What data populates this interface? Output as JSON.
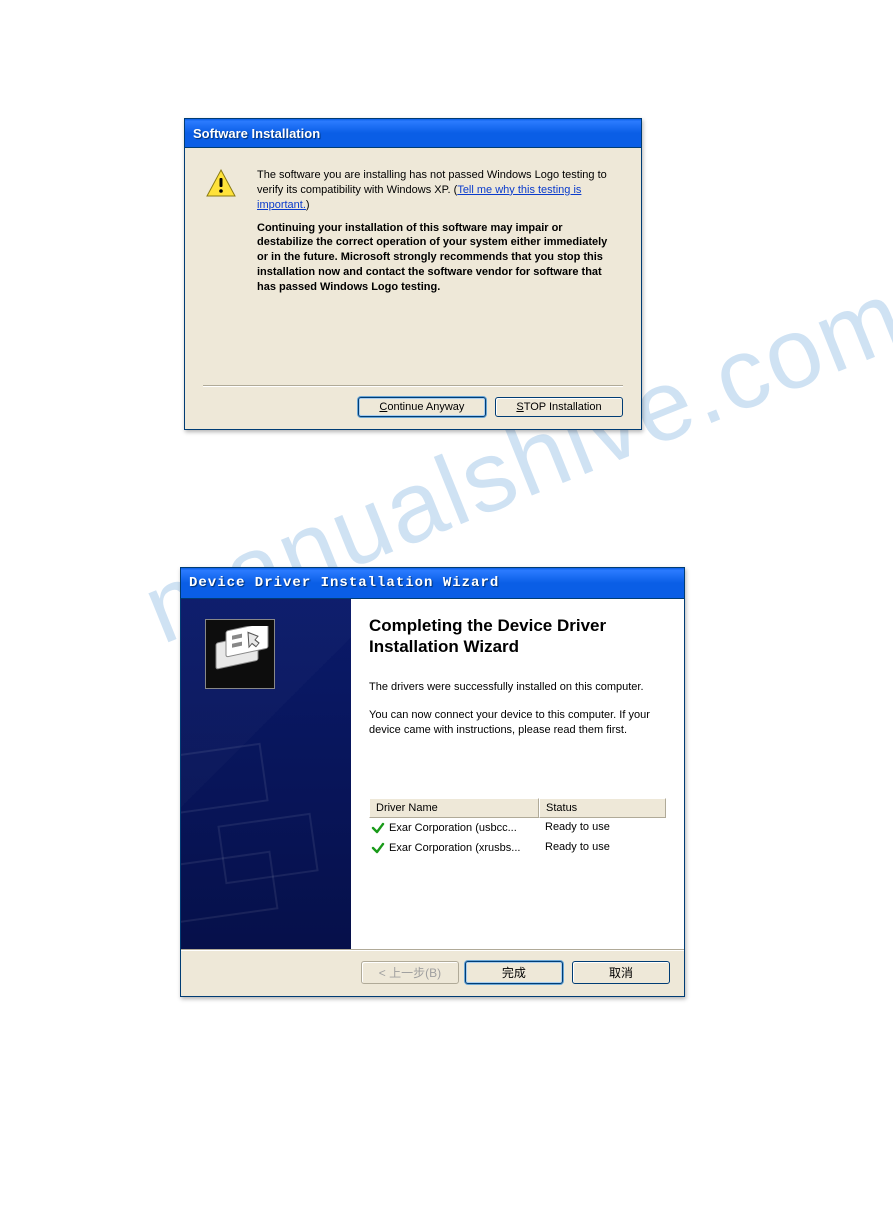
{
  "watermark_text": "manualshive.com",
  "dlg1": {
    "title": "Software Installation",
    "line1a": "The software you are installing has not passed Windows Logo testing to verify its compatibility with Windows XP. (",
    "link": "Tell me why this testing is important.",
    "line1b": ")",
    "bold": "Continuing your installation of this software may impair or destabilize the correct operation of your system either immediately or in the future. Microsoft strongly recommends that you stop this installation now and contact the software vendor for software that has passed Windows Logo testing.",
    "btn_continue_prefix": "C",
    "btn_continue_rest": "ontinue Anyway",
    "btn_stop_prefix": "S",
    "btn_stop_rest": "TOP Installation"
  },
  "dlg2": {
    "title": "Device Driver Installation Wizard",
    "heading": "Completing the Device Driver Installation Wizard",
    "msg1": "The drivers were successfully installed on this computer.",
    "msg2": "You can now connect your device to this computer. If your device came with instructions, please read them first.",
    "col_driver": "Driver Name",
    "col_status": "Status",
    "rows": [
      {
        "name": "Exar Corporation (usbcc...",
        "status": "Ready to use"
      },
      {
        "name": "Exar Corporation (xrusbs...",
        "status": "Ready to use"
      }
    ],
    "btn_back": "< 上一步(B)",
    "btn_finish": "完成",
    "btn_cancel": "取消"
  }
}
